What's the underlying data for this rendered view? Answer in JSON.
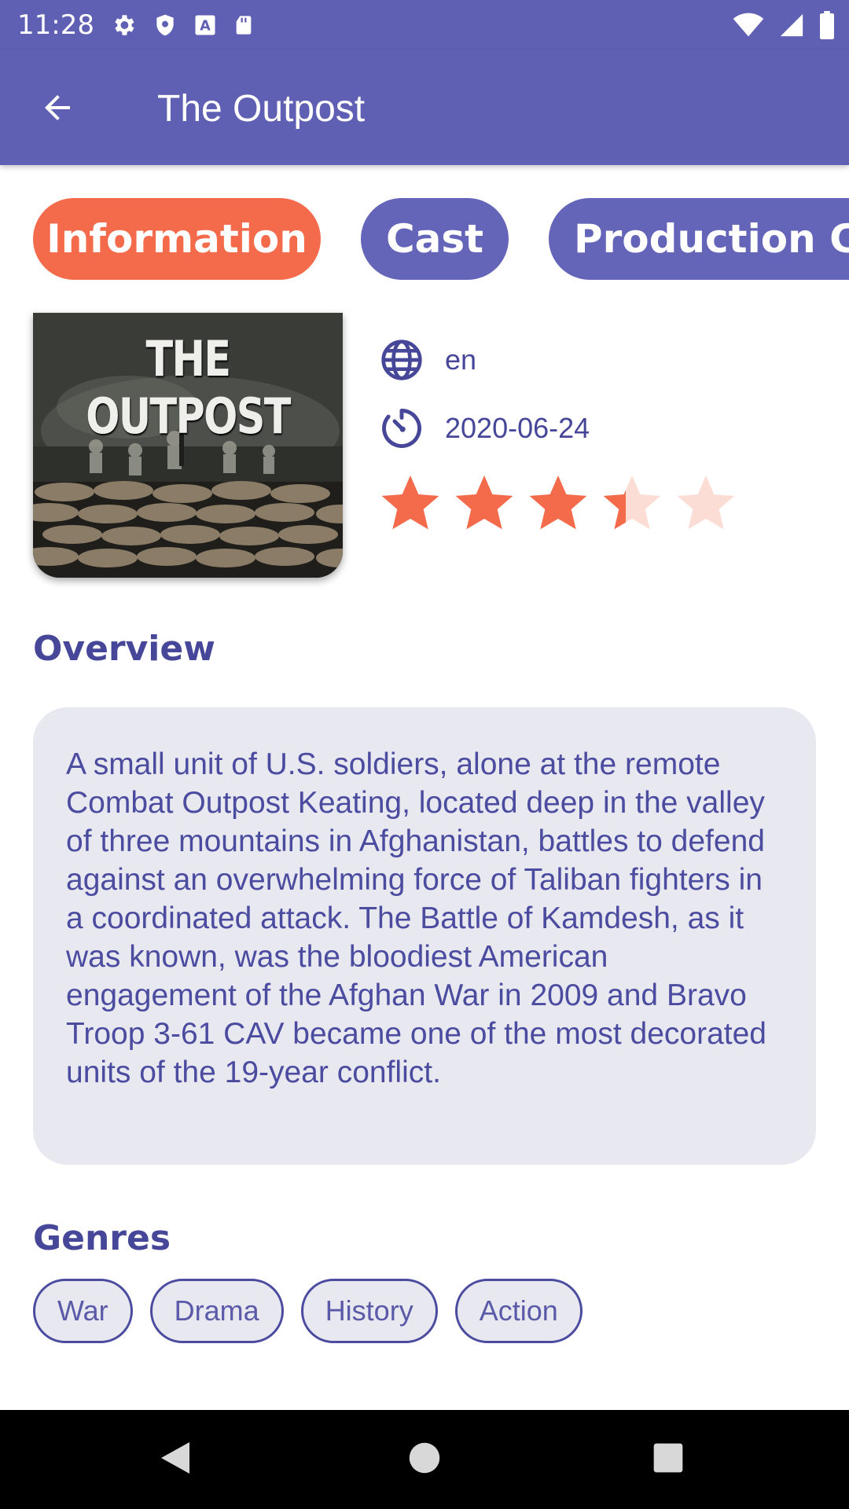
{
  "status_bar": {
    "time": "11:28",
    "icons": [
      "gear-icon",
      "shield-icon",
      "a-icon",
      "sd-card-icon",
      "wifi-icon",
      "signal-icon",
      "battery-icon"
    ]
  },
  "app_bar": {
    "title": "The Outpost",
    "back_icon": "arrow-back-icon",
    "color": "#5f5fb4"
  },
  "tabs": [
    {
      "label": "Information",
      "active": true
    },
    {
      "label": "Cast",
      "active": false
    },
    {
      "label": "Production Co",
      "active": false
    }
  ],
  "movie": {
    "poster_title": "THE OUTPOST",
    "language": "en",
    "release_date": "2020-06-24",
    "rating_stars": 3.4,
    "rating_max": 5
  },
  "overview": {
    "title": "Overview",
    "text": "A small unit of U.S. soldiers, alone at the remote Combat Outpost Keating, located deep in the valley of three mountains in Afghanistan, battles to defend against an overwhelming force of Taliban fighters in a coordinated attack. The Battle of Kamdesh, as it was known, was the bloodiest American engagement of the Afghan War in 2009 and Bravo Troop 3-61 CAV became one of the most decorated units of the 19-year conflict."
  },
  "genres": {
    "title": "Genres",
    "items": [
      "War",
      "Drama",
      "History",
      "Action"
    ]
  },
  "colors": {
    "accent": "#f36b4b",
    "primary": "#5f5fb4",
    "text": "#47479a",
    "card": "#e8e8f0"
  }
}
